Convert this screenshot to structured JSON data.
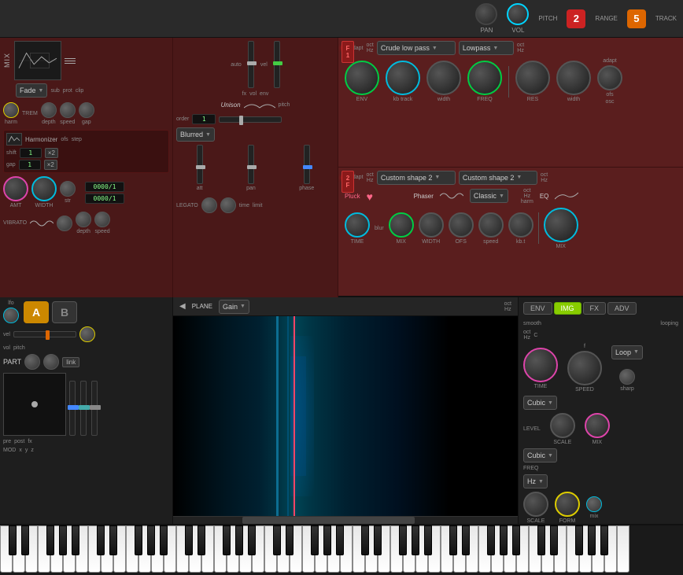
{
  "topbar": {
    "pan_label": "PAN",
    "vol_label": "VOL",
    "pitch_label": "PITCH",
    "range_label": "RANGE",
    "track_label": "TRACK",
    "range_value": "2",
    "track_value": "5"
  },
  "synth": {
    "mix_label": "MIX",
    "fade_label": "Fade",
    "sub_label": "sub",
    "prot_label": "prot",
    "clip_label": "clip",
    "auto_label": "auto",
    "vel_label": "vel",
    "fx_label": "fx",
    "vol_label": "vol",
    "env_label": "env",
    "trem_label": "TREM",
    "harm_label": "harm",
    "depth_label": "depth",
    "speed_label": "speed",
    "gap_label": "gap",
    "unison_label": "Unison",
    "pitch_label": "pitch",
    "harmonizer_label": "Harmonizer",
    "ofs_label": "ofs",
    "step_label": "step",
    "order_label": "order",
    "shift_label": "shift",
    "gap2_label": "gap",
    "blurred_label": "Blurred",
    "att_label": "att",
    "pan_label": "pan",
    "phase_label": "phase",
    "amt_label": "AMT",
    "width_label": "WIDTH",
    "str_label": "str",
    "vibrato_label": "VIBRATO",
    "depth2_label": "depth",
    "speed2_label": "speed",
    "legato_label": "LEGATO",
    "time_label": "time",
    "limit_label": "limit"
  },
  "filter1": {
    "badge": "F\n1",
    "adapt_label": "adapt",
    "oct_label": "oct",
    "hz_label": "Hz",
    "type": "Crude low pass",
    "lowpass": "Lowpass",
    "env_label": "ENV",
    "kb_track_label": "kb\ntrack",
    "width_label": "width",
    "freq_label": "FREQ",
    "res_label": "RES",
    "width2_label": "width",
    "adapt2_label": "adapt",
    "ofs_label": "ofs",
    "osc_label": "osc"
  },
  "filter2": {
    "badge": "2\nF",
    "adapt_label": "adapt",
    "oct_label": "oct",
    "hz_label": "Hz",
    "type": "Custom shape 2",
    "type2": "Custom shape 2",
    "pluck_label": "Pluck",
    "phaser_label": "Phaser",
    "classic_label": "Classic",
    "eq_label": "EQ",
    "oct2_label": "oct",
    "hz2_label": "Hz",
    "harm_label": "harm",
    "time_label": "TIME",
    "blur_label": "blur",
    "mix_label": "MIX",
    "width_label": "WIDTH",
    "ofs_label": "OFS",
    "speed_label": "speed",
    "kbt_label": "kb.t",
    "mix2_label": "MIX"
  },
  "bottom": {
    "lfo_label": "lfo",
    "vel_label": "vel",
    "vol_label": "vol",
    "pitch_label": "pitch",
    "part_label": "PART",
    "link_label": "link",
    "mod_label": "MOD",
    "x_label": "x",
    "y_label": "y",
    "z_label": "z",
    "pre_label": "pre",
    "post_label": "post",
    "fx_label": "fx",
    "plane_label": "PLANE",
    "plane_value": "Gain",
    "a_label": "A",
    "b_label": "B"
  },
  "right_bottom": {
    "env_tab": "ENV",
    "img_tab": "IMG",
    "fx_tab": "FX",
    "adv_tab": "ADV",
    "smooth_label": "smooth",
    "looping_label": "looping",
    "loop_label": "Loop",
    "time_label": "TIME",
    "speed_label": "SPEED",
    "sharp_label": "sharp",
    "cubic_label": "Cubic",
    "level_label": "LEVEL",
    "scale_label": "SCALE",
    "mix_label": "MIX",
    "freq_label": "FREQ",
    "cubic2_label": "Cubic",
    "hz_label": "Hz",
    "scale2_label": "SCALE",
    "form_label": "FORM",
    "mix2_label": "mix",
    "oct_label": "oct",
    "hz2_label": "Hz",
    "f_label": "f",
    "c_label": "C"
  }
}
